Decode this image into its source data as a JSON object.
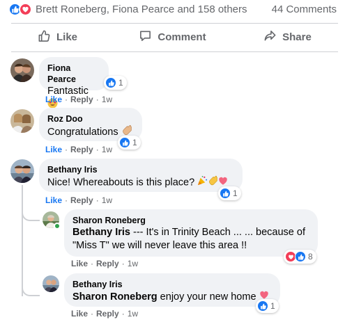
{
  "summary": {
    "names": "Brett Roneberg, Fiona Pearce and 158 others",
    "count": "44 Comments",
    "reaction_icons": [
      "like-icon",
      "love-icon"
    ]
  },
  "actions": {
    "like": "Like",
    "comment": "Comment",
    "share": "Share"
  },
  "comments": [
    {
      "author": "Fiona Pearce",
      "text": "Fantastic",
      "emoji": "star-struck-icon",
      "like_label": "Like",
      "reply_label": "Reply",
      "time": "1w",
      "reactions": "1"
    },
    {
      "author": "Roz Doo",
      "text": "Congratulations",
      "emoji": "clapping-hands-icon",
      "like_label": "Like",
      "reply_label": "Reply",
      "time": "1w",
      "reactions": "1"
    },
    {
      "author": "Bethany Iris",
      "text": "Nice! Whereabouts is this place?",
      "emoji": "party-popper-clap-heart-icons",
      "like_label": "Like",
      "reply_label": "Reply",
      "time": "1w",
      "reactions": "1"
    }
  ],
  "replies": [
    {
      "author": "Sharon Roneberg",
      "mention": "Bethany Iris",
      "text_line1": " --- It's in Trinity Beach ... ... because of",
      "text_line2": "\"Miss T\" we will never leave this area !!",
      "like_label": "Like",
      "reply_label": "Reply",
      "time": "1w",
      "reactions": "8"
    },
    {
      "author": "Bethany Iris",
      "mention": "Sharon Roneberg",
      "text": " enjoy your new home",
      "emoji": "heart-icon",
      "like_label": "Like",
      "reply_label": "Reply",
      "time": "1w",
      "reactions": "1"
    }
  ],
  "dot": "·",
  "colors": {
    "like_blue": "#1877f2",
    "love_red": "#f33e58",
    "bubble": "#f0f2f5",
    "muted": "#65676b"
  }
}
